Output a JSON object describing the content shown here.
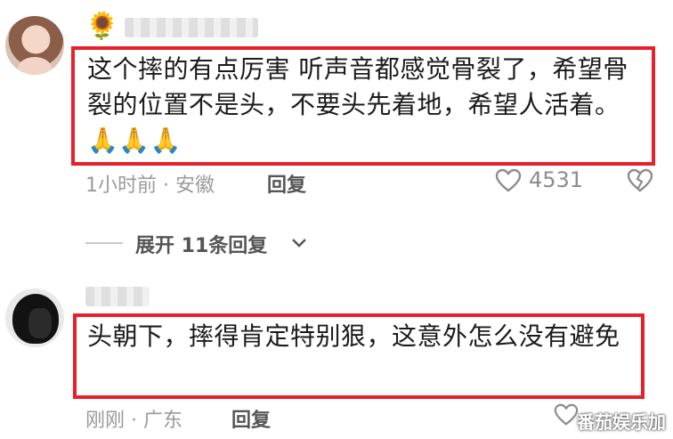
{
  "comments": [
    {
      "username_emoji": "🌻",
      "text": "这个摔的有点厉害 听声音都感觉骨裂了，希望骨裂的位置不是头，不要头先着地，希望人活着。🙏🙏🙏",
      "time": "1小时前 · 安徽",
      "reply_label": "回复",
      "likes": "4531"
    },
    {
      "text": "头朝下，摔得肯定特别狠，这意外怎么没有避免",
      "time": "刚刚 · 广东",
      "reply_label": "回复"
    }
  ],
  "expand_replies_label": "展开 11条回复",
  "watermark": "番茄娱乐加",
  "colors": {
    "highlight_border": "#e8202a",
    "meta_text": "#9a9a9a"
  },
  "icons": {
    "like": "heart-outline-icon",
    "dislike": "broken-heart-icon",
    "expand": "chevron-down-icon"
  }
}
